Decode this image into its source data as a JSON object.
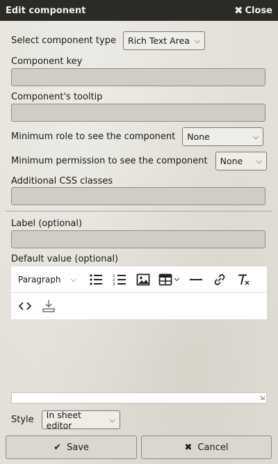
{
  "dialog": {
    "title": "Edit component",
    "close_label": "Close"
  },
  "type": {
    "label": "Select component type",
    "value": "Rich Text Area"
  },
  "key": {
    "label": "Component key",
    "value": ""
  },
  "tooltip": {
    "label": "Component's tooltip",
    "value": ""
  },
  "min_role": {
    "label": "Minimum role to see the component",
    "value": "None"
  },
  "min_perm": {
    "label": "Minimum permission to see the component",
    "value": "None"
  },
  "css": {
    "label": "Additional CSS classes",
    "value": ""
  },
  "label_field": {
    "label": "Label (optional)",
    "value": ""
  },
  "default_value": {
    "label": "Default value (optional)",
    "block_format": "Paragraph"
  },
  "toolbar_icons": [
    "bullet-list-icon",
    "numbered-list-icon",
    "image-icon",
    "table-icon",
    "horizontal-rule-icon",
    "link-icon",
    "clear-format-icon",
    "source-code-icon",
    "download-icon"
  ],
  "style": {
    "label": "Style",
    "value": "In sheet editor"
  },
  "buttons": {
    "save": "Save",
    "cancel": "Cancel"
  }
}
